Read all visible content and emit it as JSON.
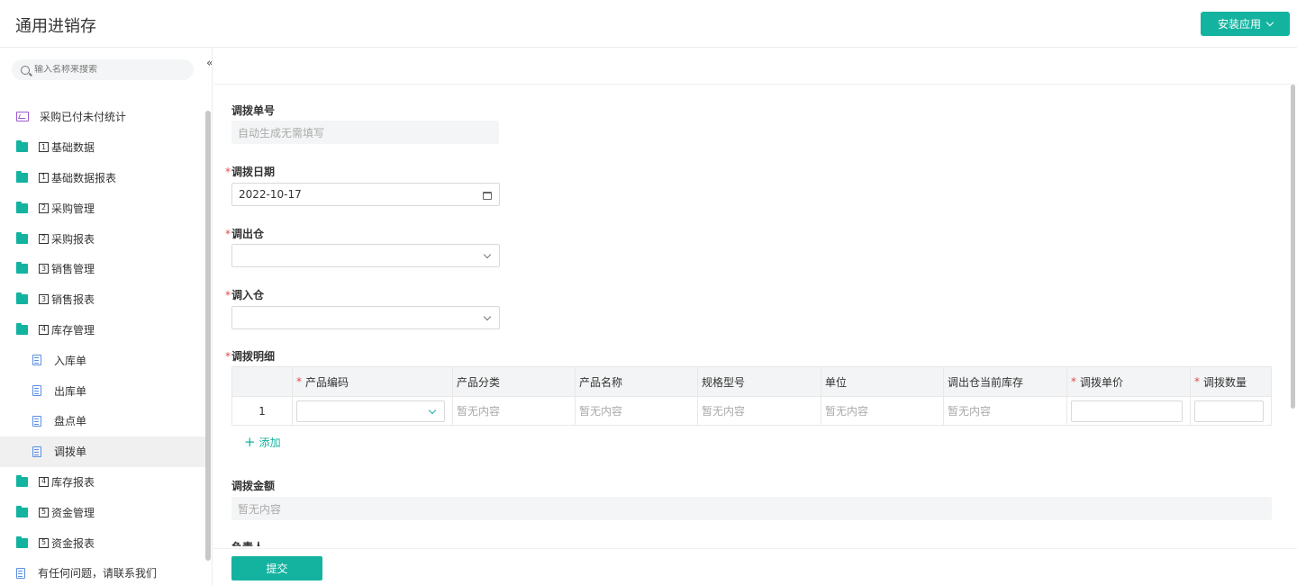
{
  "app": {
    "title": "通用进销存",
    "install_label": "安装应用"
  },
  "sidebar": {
    "search_placeholder": "输入名称来搜索",
    "items": [
      {
        "label": "采购已付未付统计",
        "icon": "chart-icon",
        "num": "",
        "child": false
      },
      {
        "label": "基础数据",
        "icon": "folder-icon",
        "num": "1",
        "child": false
      },
      {
        "label": "基础数据报表",
        "icon": "folder-icon",
        "num": "1",
        "child": false
      },
      {
        "label": "采购管理",
        "icon": "folder-icon",
        "num": "2",
        "child": false
      },
      {
        "label": "采购报表",
        "icon": "folder-icon",
        "num": "2",
        "child": false
      },
      {
        "label": "销售管理",
        "icon": "folder-icon",
        "num": "3",
        "child": false
      },
      {
        "label": "销售报表",
        "icon": "folder-icon",
        "num": "3",
        "child": false
      },
      {
        "label": "库存管理",
        "icon": "folder-icon",
        "num": "4",
        "child": false
      },
      {
        "label": "入库单",
        "icon": "doc-icon",
        "num": "",
        "child": true
      },
      {
        "label": "出库单",
        "icon": "doc-icon",
        "num": "",
        "child": true
      },
      {
        "label": "盘点单",
        "icon": "doc-icon",
        "num": "",
        "child": true
      },
      {
        "label": "调拨单",
        "icon": "doc-icon",
        "num": "",
        "child": true,
        "active": true
      },
      {
        "label": "库存报表",
        "icon": "folder-icon",
        "num": "4",
        "child": false
      },
      {
        "label": "资金管理",
        "icon": "folder-icon",
        "num": "5",
        "child": false
      },
      {
        "label": "资金报表",
        "icon": "folder-icon",
        "num": "5",
        "child": false
      },
      {
        "label": "有任何问题，请联系我们",
        "icon": "doc-icon",
        "num": "",
        "child": false
      }
    ]
  },
  "form": {
    "transfer_no": {
      "label": "调拨单号",
      "placeholder": "自动生成无需填写"
    },
    "transfer_date": {
      "label": "调拨日期",
      "value": "2022-10-17"
    },
    "out_warehouse": {
      "label": "调出仓"
    },
    "in_warehouse": {
      "label": "调入仓"
    },
    "details": {
      "label": "调拨明细",
      "columns": [
        {
          "label": "",
          "required": false
        },
        {
          "label": "产品编码",
          "required": true
        },
        {
          "label": "产品分类",
          "required": false
        },
        {
          "label": "产品名称",
          "required": false
        },
        {
          "label": "规格型号",
          "required": false
        },
        {
          "label": "单位",
          "required": false
        },
        {
          "label": "调出仓当前库存",
          "required": false
        },
        {
          "label": "调拨单价",
          "required": true
        },
        {
          "label": "调拨数量",
          "required": true
        }
      ],
      "row": {
        "index": "1",
        "empty_text": "暂无内容"
      },
      "add_label": "添加"
    },
    "amount": {
      "label": "调拨金额",
      "empty_text": "暂无内容"
    },
    "owner": {
      "label": "负责人"
    },
    "submit_label": "提交"
  },
  "colors": {
    "accent": "#14b3a0",
    "required": "#e04b4b"
  }
}
